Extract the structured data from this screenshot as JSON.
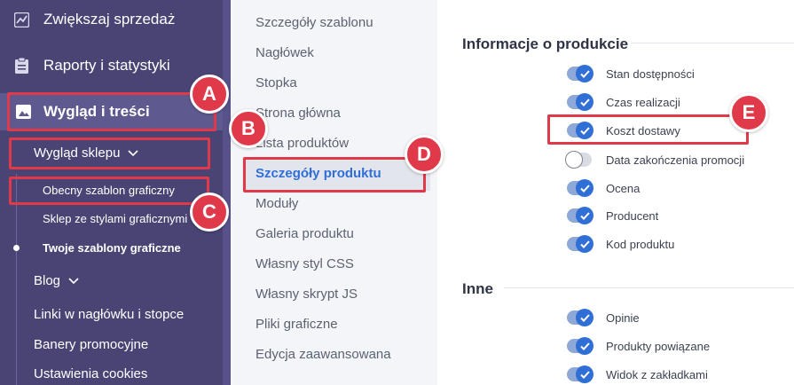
{
  "sidebar": {
    "items_top": [
      {
        "label": "Zwiększaj sprzedaż",
        "icon": "chart-icon"
      },
      {
        "label": "Raporty i statystyki",
        "icon": "clipboard-icon"
      }
    ],
    "active_item": {
      "label": "Wygląd i treści",
      "icon": "image-icon"
    },
    "submenu": {
      "label": "Wygląd sklepu",
      "children": [
        "Obecny szablon graficzny",
        "Sklep ze stylami graficznymi",
        "Twoje szablony graficzne"
      ]
    },
    "more": {
      "blog": "Blog",
      "links": "Linki w nagłówku i stopce",
      "banners": "Banery promocyjne",
      "cookies": "Ustawienia cookies"
    }
  },
  "middle_menu": {
    "items": [
      "Szczegóły szablonu",
      "Nagłówek",
      "Stopka",
      "Strona główna",
      "Lista produktów",
      "Szczegóły produktu",
      "Moduły",
      "Galeria produktu",
      "Własny styl CSS",
      "Własny skrypt JS",
      "Pliki graficzne",
      "Edycja zaawansowana"
    ],
    "active": "Szczegóły produktu"
  },
  "settings": {
    "section1": {
      "title": "Informacje o produkcie",
      "toggles": [
        {
          "label": "Stan dostępności",
          "on": true
        },
        {
          "label": "Czas realizacji",
          "on": true
        },
        {
          "label": "Koszt dostawy",
          "on": true
        },
        {
          "label": "Data zakończenia promocji",
          "on": false
        },
        {
          "label": "Ocena",
          "on": true
        },
        {
          "label": "Producent",
          "on": true
        },
        {
          "label": "Kod produktu",
          "on": true
        }
      ]
    },
    "section2": {
      "title": "Inne",
      "toggles": [
        {
          "label": "Opinie",
          "on": true
        },
        {
          "label": "Produkty powiązane",
          "on": true
        },
        {
          "label": "Widok z zakładkami",
          "on": true
        }
      ]
    }
  },
  "markers": {
    "a": "A",
    "b": "B",
    "c": "C",
    "d": "D",
    "e": "E"
  },
  "colors": {
    "sidebar": "#4a4475",
    "highlight": "#e03a4a",
    "accent": "#2f6fd6"
  }
}
